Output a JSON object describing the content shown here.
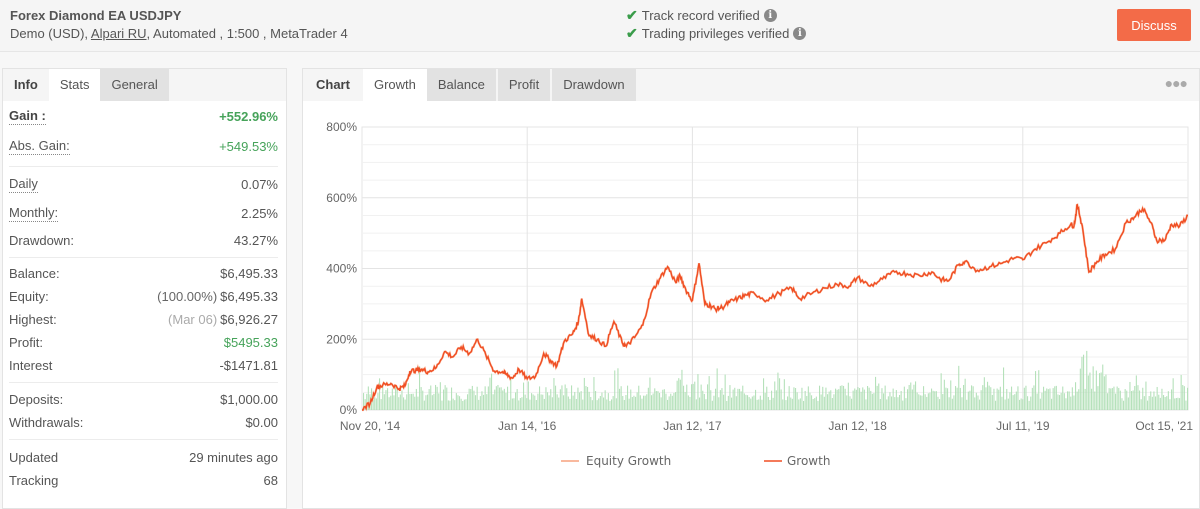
{
  "header": {
    "title": "Forex Diamond EA USDJPY",
    "account_type": "Demo (USD),",
    "broker": "Alpari RU",
    "details": ", Automated , 1:500 , MetaTrader 4",
    "verifications": [
      "Track record verified",
      "Trading privileges verified"
    ],
    "discuss_label": "Discuss"
  },
  "left_tabs": {
    "label": "Info",
    "items": [
      "Stats",
      "General"
    ],
    "active": "Stats"
  },
  "stats": {
    "gain": {
      "label": "Gain :",
      "value": "+552.96%"
    },
    "abs_gain": {
      "label": "Abs. Gain:",
      "value": "+549.53%"
    },
    "daily": {
      "label": "Daily",
      "value": "0.07%"
    },
    "monthly": {
      "label": "Monthly:",
      "value": "2.25%"
    },
    "drawdown": {
      "label": "Drawdown:",
      "value": "43.27%"
    },
    "balance": {
      "label": "Balance:",
      "value": "$6,495.33"
    },
    "equity": {
      "label": "Equity:",
      "note": "(100.00%)",
      "value": "$6,495.33"
    },
    "highest": {
      "label": "Highest:",
      "note": "(Mar 06)",
      "value": "$6,926.27"
    },
    "profit": {
      "label": "Profit:",
      "value": "$5495.33"
    },
    "interest": {
      "label": "Interest",
      "value": "-$1471.81"
    },
    "deposits": {
      "label": "Deposits:",
      "value": "$1,000.00"
    },
    "withdrawals": {
      "label": "Withdrawals:",
      "value": "$0.00"
    },
    "updated": {
      "label": "Updated",
      "value": "29 minutes ago"
    },
    "tracking": {
      "label": "Tracking",
      "value": "68"
    }
  },
  "chart_tabs": {
    "label": "Chart",
    "items": [
      "Growth",
      "Balance",
      "Profit",
      "Drawdown"
    ],
    "active": "Growth",
    "more_icon": "ellipsis-icon"
  },
  "colors": {
    "growth": "#f04e23",
    "equity": "#f7a27f",
    "volume": "#a8dcae",
    "discuss": "#f36b48",
    "positive": "#46a35a"
  },
  "chart_data": {
    "type": "line",
    "title": "",
    "xlabel": "",
    "ylabel": "",
    "ylim": [
      0,
      800
    ],
    "yticks": [
      "0%",
      "200%",
      "400%",
      "600%",
      "800%"
    ],
    "ytick_values": [
      0,
      200,
      400,
      600,
      800
    ],
    "xticks": [
      "Nov 20, '14",
      "Jan 14, '16",
      "Jan 12, '17",
      "Jan 12, '18",
      "Jul 11, '19",
      "Oct 15, '21"
    ],
    "xtick_positions": [
      0.0,
      0.2,
      0.4,
      0.6,
      0.8,
      1.0
    ],
    "grid": true,
    "legend": {
      "position": "bottom",
      "entries": [
        "Equity Growth",
        "Growth"
      ]
    },
    "series": [
      {
        "name": "Growth",
        "x": [
          0.0,
          0.01,
          0.018,
          0.025,
          0.035,
          0.045,
          0.052,
          0.058,
          0.065,
          0.072,
          0.08,
          0.09,
          0.1,
          0.11,
          0.12,
          0.13,
          0.14,
          0.15,
          0.16,
          0.17,
          0.175,
          0.182,
          0.19,
          0.2,
          0.21,
          0.22,
          0.228,
          0.236,
          0.245,
          0.255,
          0.262,
          0.266,
          0.275,
          0.285,
          0.295,
          0.305,
          0.315,
          0.32,
          0.33,
          0.34,
          0.35,
          0.36,
          0.37,
          0.38,
          0.385,
          0.392,
          0.4,
          0.408,
          0.415,
          0.422,
          0.428,
          0.436,
          0.445,
          0.455,
          0.465,
          0.475,
          0.49,
          0.505,
          0.52,
          0.53,
          0.545,
          0.56,
          0.575,
          0.59,
          0.6,
          0.615,
          0.63,
          0.645,
          0.66,
          0.675,
          0.69,
          0.7,
          0.71,
          0.722,
          0.73,
          0.745,
          0.76,
          0.775,
          0.79,
          0.8,
          0.815,
          0.83,
          0.845,
          0.858,
          0.862,
          0.866,
          0.872,
          0.88,
          0.89,
          0.9,
          0.912,
          0.925,
          0.935,
          0.945,
          0.955,
          0.962,
          0.972,
          0.98,
          0.99,
          1.0
        ],
        "values": [
          0,
          20,
          65,
          70,
          75,
          60,
          68,
          110,
          112,
          115,
          108,
          120,
          165,
          150,
          178,
          160,
          200,
          155,
          110,
          108,
          100,
          90,
          115,
          88,
          95,
          160,
          140,
          125,
          195,
          215,
          250,
          315,
          210,
          200,
          180,
          250,
          190,
          180,
          205,
          240,
          330,
          370,
          405,
          360,
          380,
          340,
          310,
          415,
          300,
          295,
          285,
          290,
          305,
          315,
          325,
          330,
          310,
          330,
          345,
          315,
          330,
          345,
          355,
          350,
          375,
          350,
          370,
          390,
          385,
          380,
          390,
          370,
          365,
          410,
          420,
          395,
          405,
          415,
          430,
          425,
          455,
          475,
          500,
          525,
          520,
          580,
          520,
          390,
          420,
          440,
          455,
          530,
          545,
          570,
          530,
          480,
          480,
          525,
          520,
          550
        ]
      },
      {
        "name": "Equity Growth",
        "same_as": "Growth"
      }
    ]
  }
}
